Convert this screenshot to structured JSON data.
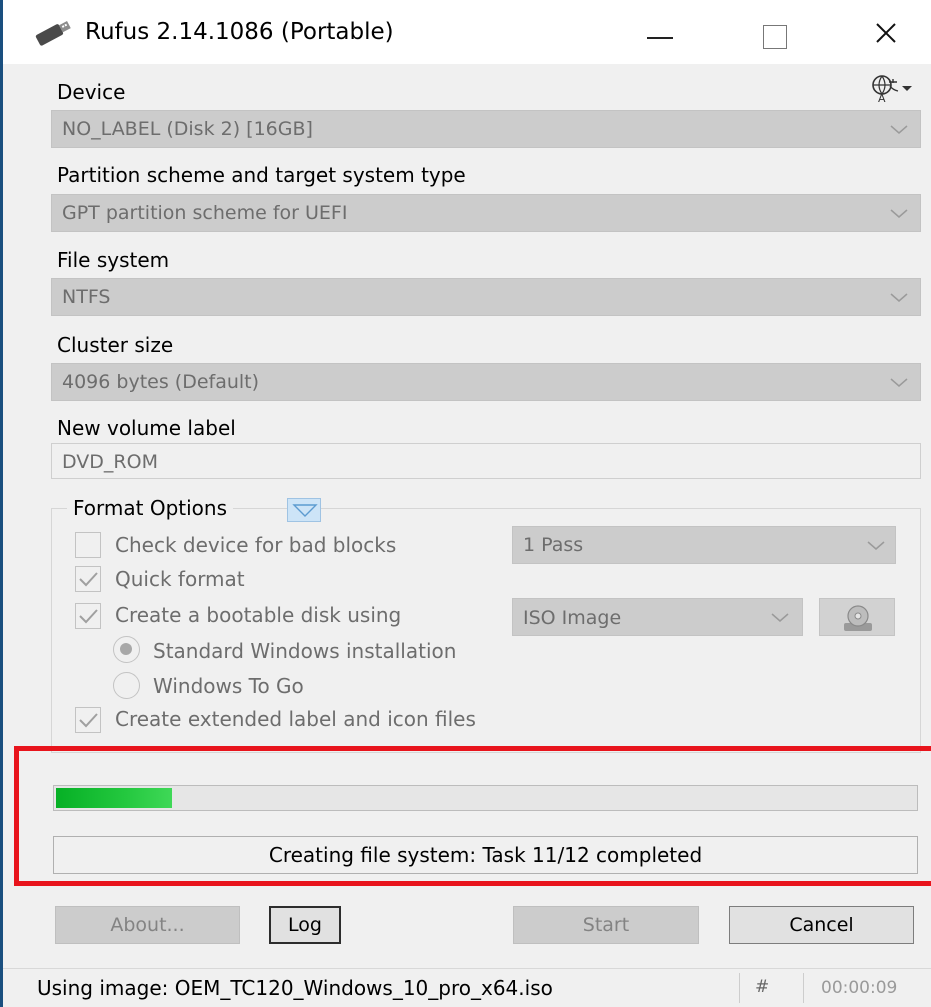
{
  "window": {
    "title": "Rufus 2.14.1086 (Portable)"
  },
  "device": {
    "label": "Device",
    "value": "NO_LABEL (Disk 2) [16GB]"
  },
  "partition": {
    "label": "Partition scheme and target system type",
    "value": "GPT partition scheme for UEFI"
  },
  "filesystem": {
    "label": "File system",
    "value": "NTFS"
  },
  "cluster": {
    "label": "Cluster size",
    "value": "4096 bytes (Default)"
  },
  "volume": {
    "label": "New volume label",
    "value": "DVD_ROM"
  },
  "format_options": {
    "title": "Format Options",
    "bad_blocks": {
      "label": "Check device for bad blocks",
      "checked": false,
      "passes": "1 Pass"
    },
    "quick_format": {
      "label": "Quick format",
      "checked": true
    },
    "bootable": {
      "label": "Create a bootable disk using",
      "checked": true,
      "source": "ISO Image"
    },
    "standard_windows": {
      "label": "Standard Windows installation",
      "selected": true
    },
    "windows_to_go": {
      "label": "Windows To Go",
      "selected": false
    },
    "extended_label": {
      "label": "Create extended label and icon files",
      "checked": true
    }
  },
  "progress": {
    "fraction": 0.135,
    "status": "Creating file system: Task 11/12 completed"
  },
  "buttons": {
    "about": "About...",
    "log": "Log",
    "start": "Start",
    "cancel": "Cancel"
  },
  "statusbar": {
    "message": "Using image: OEM_TC120_Windows_10_pro_x64.iso",
    "hash": "#",
    "elapsed": "00:00:09"
  },
  "colors": {
    "highlight": "#e8141c",
    "progress": "#06b025",
    "disabled_field": "#cccccc"
  }
}
